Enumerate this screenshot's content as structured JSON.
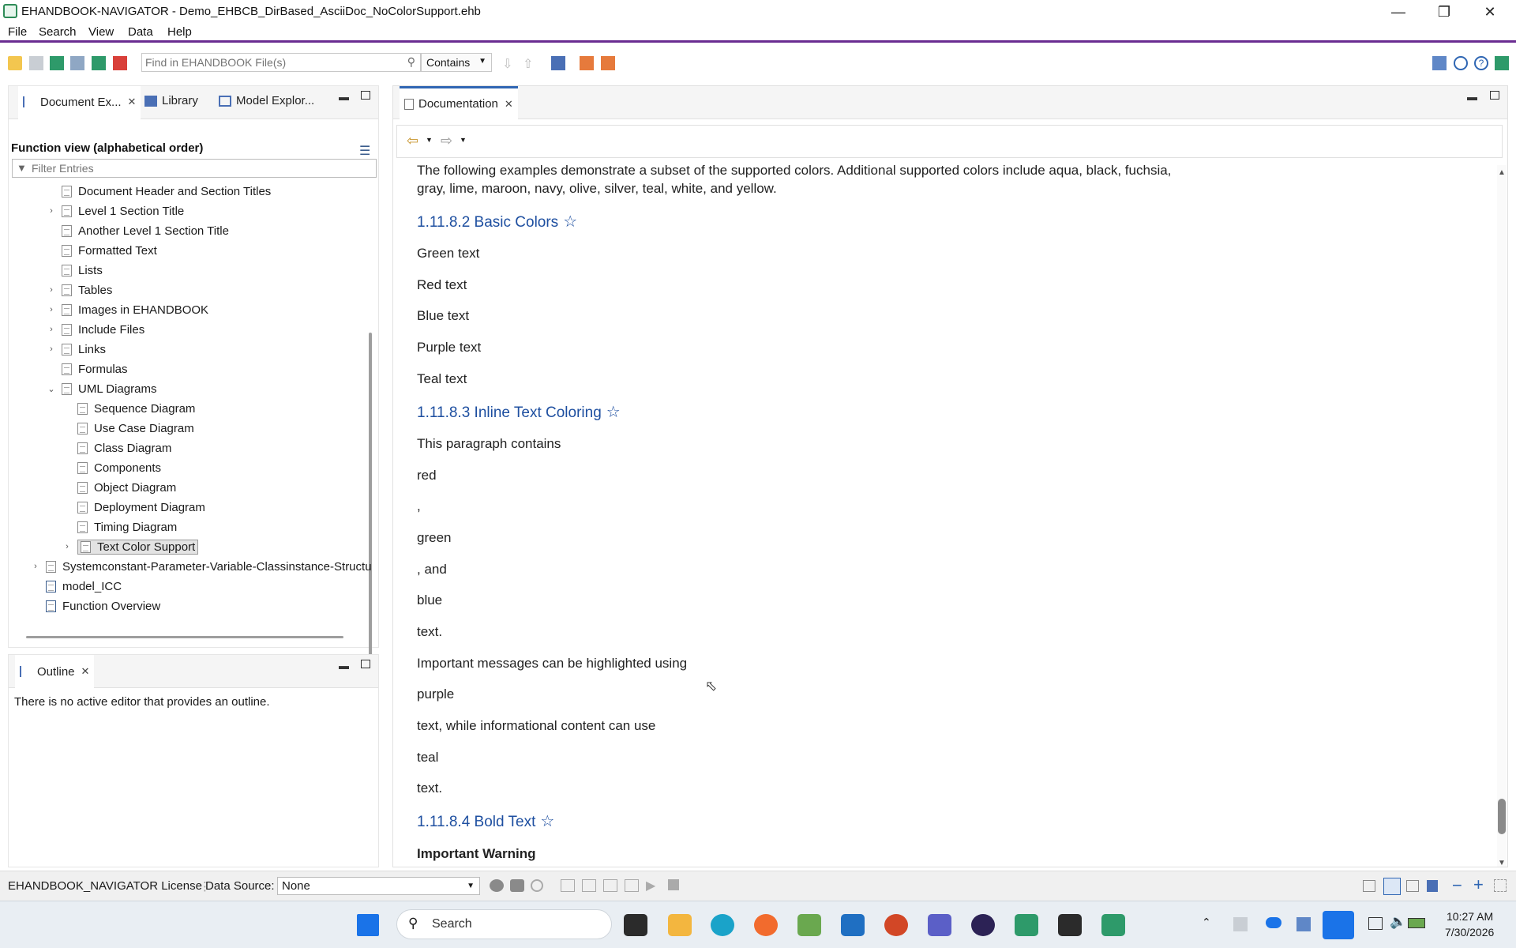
{
  "window": {
    "title": "EHANDBOOK-NAVIGATOR - Demo_EHBCB_DirBased_AsciiDoc_NoColorSupport.ehb"
  },
  "menu": {
    "file": "File",
    "search": "Search",
    "view": "View",
    "data": "Data",
    "help": "Help"
  },
  "toolbar": {
    "search_placeholder": "Find in EHANDBOOK File(s)",
    "contains": "Contains"
  },
  "left_panel": {
    "tabs": {
      "document_explorer": "Document Ex...",
      "library": "Library",
      "model_explorer": "Model Explor..."
    },
    "header": "Function view (alphabetical order)",
    "filter_placeholder": "Filter Entries",
    "tree": [
      {
        "label": "Document Header and Section Titles",
        "expand": ""
      },
      {
        "label": "Level 1 Section Title",
        "expand": "›"
      },
      {
        "label": "Another Level 1 Section Title",
        "expand": ""
      },
      {
        "label": "Formatted Text",
        "expand": ""
      },
      {
        "label": "Lists",
        "expand": ""
      },
      {
        "label": "Tables",
        "expand": "›"
      },
      {
        "label": "Images in EHANDBOOK",
        "expand": "›"
      },
      {
        "label": "Include Files",
        "expand": "›"
      },
      {
        "label": "Links",
        "expand": "›"
      },
      {
        "label": "Formulas",
        "expand": ""
      },
      {
        "label": "UML Diagrams",
        "expand": "⌄"
      },
      {
        "label": "Sequence Diagram",
        "expand": ""
      },
      {
        "label": "Use Case Diagram",
        "expand": ""
      },
      {
        "label": "Class Diagram",
        "expand": ""
      },
      {
        "label": "Components",
        "expand": ""
      },
      {
        "label": "Object Diagram",
        "expand": ""
      },
      {
        "label": "Deployment Diagram",
        "expand": ""
      },
      {
        "label": "Timing Diagram",
        "expand": ""
      },
      {
        "label": "Text Color Support",
        "expand": "›"
      },
      {
        "label": "Systemconstant-Parameter-Variable-Classinstance-Structu",
        "expand": "›"
      },
      {
        "label": "model_ICC",
        "expand": ""
      },
      {
        "label": "Function Overview",
        "expand": ""
      }
    ]
  },
  "outline_panel": {
    "tab": "Outline",
    "message": "There is no active editor that provides an outline."
  },
  "doc_panel": {
    "tab": "Documentation",
    "intro_line1": "The following examples demonstrate a subset of the supported colors. Additional supported colors include aqua, black, fuchsia,",
    "intro_line2": "gray, lime, maroon, navy, olive, silver, teal, white, and yellow.",
    "h_basic": "1.11.8.2 Basic Colors",
    "basic": [
      "Green text",
      "Red text",
      "Blue text",
      "Purple text",
      "Teal text"
    ],
    "h_inline": "1.11.8.3 Inline Text Coloring",
    "inline": [
      "This paragraph contains",
      "red",
      ",",
      "green",
      ", and",
      "blue",
      "text.",
      "Important messages can be highlighted using",
      "purple",
      "text, while informational content can use",
      "teal",
      "text."
    ],
    "h_bold": "1.11.8.4 Bold Text",
    "bold_line": "Important Warning"
  },
  "status": {
    "license": "EHANDBOOK_NAVIGATOR License",
    "data_source_label": "Data Source:",
    "data_source_value": "None"
  },
  "taskbar": {
    "search": "Search",
    "time": "10:27 AM",
    "date": "7/30/2026"
  }
}
